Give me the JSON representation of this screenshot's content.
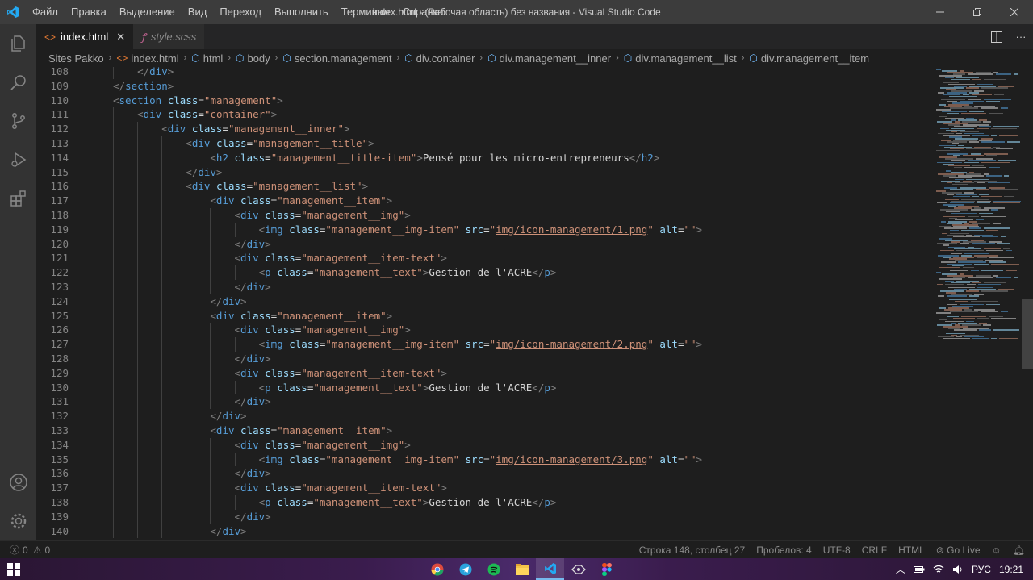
{
  "titlebar": {
    "menu": [
      "Файл",
      "Правка",
      "Выделение",
      "Вид",
      "Переход",
      "Выполнить",
      "Терминал",
      "Справка"
    ],
    "title": "index.html - (Рабочая область) без названия - Visual Studio Code"
  },
  "tabs": [
    {
      "label": "index.html",
      "icon": "html-file-icon",
      "active": true
    },
    {
      "label": "style.scss",
      "icon": "scss-file-icon",
      "active": false
    }
  ],
  "breadcrumb": [
    "Sites Pakko",
    "index.html",
    "html",
    "body",
    "section.management",
    "div.container",
    "div.management__inner",
    "div.management__list",
    "div.management__item"
  ],
  "editor": {
    "lines": [
      {
        "n": "108",
        "indent": 1,
        "tokens": [
          [
            "br",
            "</"
          ],
          [
            "tag",
            "div"
          ],
          [
            "br",
            ">"
          ]
        ]
      },
      {
        "n": "109",
        "indent": 0,
        "tokens": [
          [
            "br",
            "</"
          ],
          [
            "tag",
            "section"
          ],
          [
            "br",
            ">"
          ]
        ]
      },
      {
        "n": "110",
        "indent": 0,
        "tokens": [
          [
            "br",
            "<"
          ],
          [
            "tag",
            "section"
          ],
          [
            "txt",
            " "
          ],
          [
            "attr",
            "class"
          ],
          [
            "eq",
            "="
          ],
          [
            "str",
            "\"management\""
          ],
          [
            "br",
            ">"
          ]
        ]
      },
      {
        "n": "111",
        "indent": 1,
        "tokens": [
          [
            "br",
            "<"
          ],
          [
            "tag",
            "div"
          ],
          [
            "txt",
            " "
          ],
          [
            "attr",
            "class"
          ],
          [
            "eq",
            "="
          ],
          [
            "str",
            "\"container\""
          ],
          [
            "br",
            ">"
          ]
        ]
      },
      {
        "n": "112",
        "indent": 2,
        "tokens": [
          [
            "br",
            "<"
          ],
          [
            "tag",
            "div"
          ],
          [
            "txt",
            " "
          ],
          [
            "attr",
            "class"
          ],
          [
            "eq",
            "="
          ],
          [
            "str",
            "\"management__inner\""
          ],
          [
            "br",
            ">"
          ]
        ]
      },
      {
        "n": "113",
        "indent": 3,
        "tokens": [
          [
            "br",
            "<"
          ],
          [
            "tag",
            "div"
          ],
          [
            "txt",
            " "
          ],
          [
            "attr",
            "class"
          ],
          [
            "eq",
            "="
          ],
          [
            "str",
            "\"management__title\""
          ],
          [
            "br",
            ">"
          ]
        ]
      },
      {
        "n": "114",
        "indent": 4,
        "tokens": [
          [
            "br",
            "<"
          ],
          [
            "tag",
            "h2"
          ],
          [
            "txt",
            " "
          ],
          [
            "attr",
            "class"
          ],
          [
            "eq",
            "="
          ],
          [
            "str",
            "\"management__title-item\""
          ],
          [
            "br",
            ">"
          ],
          [
            "txt",
            "Pensé pour les micro-entrepreneurs"
          ],
          [
            "br",
            "</"
          ],
          [
            "tag",
            "h2"
          ],
          [
            "br",
            ">"
          ]
        ]
      },
      {
        "n": "115",
        "indent": 3,
        "tokens": [
          [
            "br",
            "</"
          ],
          [
            "tag",
            "div"
          ],
          [
            "br",
            ">"
          ]
        ]
      },
      {
        "n": "116",
        "indent": 3,
        "tokens": [
          [
            "br",
            "<"
          ],
          [
            "tag",
            "div"
          ],
          [
            "txt",
            " "
          ],
          [
            "attr",
            "class"
          ],
          [
            "eq",
            "="
          ],
          [
            "str",
            "\"management__list\""
          ],
          [
            "br",
            ">"
          ]
        ]
      },
      {
        "n": "117",
        "indent": 4,
        "tokens": [
          [
            "br",
            "<"
          ],
          [
            "tag",
            "div"
          ],
          [
            "txt",
            " "
          ],
          [
            "attr",
            "class"
          ],
          [
            "eq",
            "="
          ],
          [
            "str",
            "\"management__item\""
          ],
          [
            "br",
            ">"
          ]
        ]
      },
      {
        "n": "118",
        "indent": 5,
        "tokens": [
          [
            "br",
            "<"
          ],
          [
            "tag",
            "div"
          ],
          [
            "txt",
            " "
          ],
          [
            "attr",
            "class"
          ],
          [
            "eq",
            "="
          ],
          [
            "str",
            "\"management__img\""
          ],
          [
            "br",
            ">"
          ]
        ]
      },
      {
        "n": "119",
        "indent": 6,
        "tokens": [
          [
            "br",
            "<"
          ],
          [
            "tag",
            "img"
          ],
          [
            "txt",
            " "
          ],
          [
            "attr",
            "class"
          ],
          [
            "eq",
            "="
          ],
          [
            "str",
            "\"management__img-item\""
          ],
          [
            "txt",
            " "
          ],
          [
            "attr",
            "src"
          ],
          [
            "eq",
            "="
          ],
          [
            "str",
            "\""
          ],
          [
            "link",
            "img/icon-management/1.png"
          ],
          [
            "str",
            "\""
          ],
          [
            "txt",
            " "
          ],
          [
            "attr",
            "alt"
          ],
          [
            "eq",
            "="
          ],
          [
            "str",
            "\"\""
          ],
          [
            "br",
            ">"
          ]
        ]
      },
      {
        "n": "120",
        "indent": 5,
        "tokens": [
          [
            "br",
            "</"
          ],
          [
            "tag",
            "div"
          ],
          [
            "br",
            ">"
          ]
        ]
      },
      {
        "n": "121",
        "indent": 5,
        "tokens": [
          [
            "br",
            "<"
          ],
          [
            "tag",
            "div"
          ],
          [
            "txt",
            " "
          ],
          [
            "attr",
            "class"
          ],
          [
            "eq",
            "="
          ],
          [
            "str",
            "\"management__item-text\""
          ],
          [
            "br",
            ">"
          ]
        ]
      },
      {
        "n": "122",
        "indent": 6,
        "tokens": [
          [
            "br",
            "<"
          ],
          [
            "tag",
            "p"
          ],
          [
            "txt",
            " "
          ],
          [
            "attr",
            "class"
          ],
          [
            "eq",
            "="
          ],
          [
            "str",
            "\"management__text\""
          ],
          [
            "br",
            ">"
          ],
          [
            "txt",
            "Gestion de l'ACRE"
          ],
          [
            "br",
            "</"
          ],
          [
            "tag",
            "p"
          ],
          [
            "br",
            ">"
          ]
        ]
      },
      {
        "n": "123",
        "indent": 5,
        "tokens": [
          [
            "br",
            "</"
          ],
          [
            "tag",
            "div"
          ],
          [
            "br",
            ">"
          ]
        ]
      },
      {
        "n": "124",
        "indent": 4,
        "tokens": [
          [
            "br",
            "</"
          ],
          [
            "tag",
            "div"
          ],
          [
            "br",
            ">"
          ]
        ]
      },
      {
        "n": "125",
        "indent": 4,
        "tokens": [
          [
            "br",
            "<"
          ],
          [
            "tag",
            "div"
          ],
          [
            "txt",
            " "
          ],
          [
            "attr",
            "class"
          ],
          [
            "eq",
            "="
          ],
          [
            "str",
            "\"management__item\""
          ],
          [
            "br",
            ">"
          ]
        ]
      },
      {
        "n": "126",
        "indent": 5,
        "tokens": [
          [
            "br",
            "<"
          ],
          [
            "tag",
            "div"
          ],
          [
            "txt",
            " "
          ],
          [
            "attr",
            "class"
          ],
          [
            "eq",
            "="
          ],
          [
            "str",
            "\"management__img\""
          ],
          [
            "br",
            ">"
          ]
        ]
      },
      {
        "n": "127",
        "indent": 6,
        "tokens": [
          [
            "br",
            "<"
          ],
          [
            "tag",
            "img"
          ],
          [
            "txt",
            " "
          ],
          [
            "attr",
            "class"
          ],
          [
            "eq",
            "="
          ],
          [
            "str",
            "\"management__img-item\""
          ],
          [
            "txt",
            " "
          ],
          [
            "attr",
            "src"
          ],
          [
            "eq",
            "="
          ],
          [
            "str",
            "\""
          ],
          [
            "link",
            "img/icon-management/2.png"
          ],
          [
            "str",
            "\""
          ],
          [
            "txt",
            " "
          ],
          [
            "attr",
            "alt"
          ],
          [
            "eq",
            "="
          ],
          [
            "str",
            "\"\""
          ],
          [
            "br",
            ">"
          ]
        ]
      },
      {
        "n": "128",
        "indent": 5,
        "tokens": [
          [
            "br",
            "</"
          ],
          [
            "tag",
            "div"
          ],
          [
            "br",
            ">"
          ]
        ]
      },
      {
        "n": "129",
        "indent": 5,
        "tokens": [
          [
            "br",
            "<"
          ],
          [
            "tag",
            "div"
          ],
          [
            "txt",
            " "
          ],
          [
            "attr",
            "class"
          ],
          [
            "eq",
            "="
          ],
          [
            "str",
            "\"management__item-text\""
          ],
          [
            "br",
            ">"
          ]
        ]
      },
      {
        "n": "130",
        "indent": 6,
        "tokens": [
          [
            "br",
            "<"
          ],
          [
            "tag",
            "p"
          ],
          [
            "txt",
            " "
          ],
          [
            "attr",
            "class"
          ],
          [
            "eq",
            "="
          ],
          [
            "str",
            "\"management__text\""
          ],
          [
            "br",
            ">"
          ],
          [
            "txt",
            "Gestion de l'ACRE"
          ],
          [
            "br",
            "</"
          ],
          [
            "tag",
            "p"
          ],
          [
            "br",
            ">"
          ]
        ]
      },
      {
        "n": "131",
        "indent": 5,
        "tokens": [
          [
            "br",
            "</"
          ],
          [
            "tag",
            "div"
          ],
          [
            "br",
            ">"
          ]
        ]
      },
      {
        "n": "132",
        "indent": 4,
        "tokens": [
          [
            "br",
            "</"
          ],
          [
            "tag",
            "div"
          ],
          [
            "br",
            ">"
          ]
        ]
      },
      {
        "n": "133",
        "indent": 4,
        "tokens": [
          [
            "br",
            "<"
          ],
          [
            "tag",
            "div"
          ],
          [
            "txt",
            " "
          ],
          [
            "attr",
            "class"
          ],
          [
            "eq",
            "="
          ],
          [
            "str",
            "\"management__item\""
          ],
          [
            "br",
            ">"
          ]
        ]
      },
      {
        "n": "134",
        "indent": 5,
        "tokens": [
          [
            "br",
            "<"
          ],
          [
            "tag",
            "div"
          ],
          [
            "txt",
            " "
          ],
          [
            "attr",
            "class"
          ],
          [
            "eq",
            "="
          ],
          [
            "str",
            "\"management__img\""
          ],
          [
            "br",
            ">"
          ]
        ]
      },
      {
        "n": "135",
        "indent": 6,
        "tokens": [
          [
            "br",
            "<"
          ],
          [
            "tag",
            "img"
          ],
          [
            "txt",
            " "
          ],
          [
            "attr",
            "class"
          ],
          [
            "eq",
            "="
          ],
          [
            "str",
            "\"management__img-item\""
          ],
          [
            "txt",
            " "
          ],
          [
            "attr",
            "src"
          ],
          [
            "eq",
            "="
          ],
          [
            "str",
            "\""
          ],
          [
            "link",
            "img/icon-management/3.png"
          ],
          [
            "str",
            "\""
          ],
          [
            "txt",
            " "
          ],
          [
            "attr",
            "alt"
          ],
          [
            "eq",
            "="
          ],
          [
            "str",
            "\"\""
          ],
          [
            "br",
            ">"
          ]
        ]
      },
      {
        "n": "136",
        "indent": 5,
        "tokens": [
          [
            "br",
            "</"
          ],
          [
            "tag",
            "div"
          ],
          [
            "br",
            ">"
          ]
        ]
      },
      {
        "n": "137",
        "indent": 5,
        "tokens": [
          [
            "br",
            "<"
          ],
          [
            "tag",
            "div"
          ],
          [
            "txt",
            " "
          ],
          [
            "attr",
            "class"
          ],
          [
            "eq",
            "="
          ],
          [
            "str",
            "\"management__item-text\""
          ],
          [
            "br",
            ">"
          ]
        ]
      },
      {
        "n": "138",
        "indent": 6,
        "tokens": [
          [
            "br",
            "<"
          ],
          [
            "tag",
            "p"
          ],
          [
            "txt",
            " "
          ],
          [
            "attr",
            "class"
          ],
          [
            "eq",
            "="
          ],
          [
            "str",
            "\"management__text\""
          ],
          [
            "br",
            ">"
          ],
          [
            "txt",
            "Gestion de l'ACRE"
          ],
          [
            "br",
            "</"
          ],
          [
            "tag",
            "p"
          ],
          [
            "br",
            ">"
          ]
        ]
      },
      {
        "n": "139",
        "indent": 5,
        "tokens": [
          [
            "br",
            "</"
          ],
          [
            "tag",
            "div"
          ],
          [
            "br",
            ">"
          ]
        ]
      },
      {
        "n": "140",
        "indent": 4,
        "tokens": [
          [
            "br",
            "</"
          ],
          [
            "tag",
            "div"
          ],
          [
            "br",
            ">"
          ]
        ]
      }
    ]
  },
  "statusbar": {
    "errors": "0",
    "warnings": "0",
    "position": "Строка 148, столбец 27",
    "spaces": "Пробелов: 4",
    "encoding": "UTF-8",
    "eol": "CRLF",
    "language": "HTML",
    "golive": "Go Live"
  },
  "taskbar": {
    "apps": [
      "chrome-icon",
      "telegram-icon",
      "spotify-icon",
      "file-explorer-icon",
      "vscode-icon",
      "app-icon",
      "figma-icon"
    ],
    "lang": "РУС",
    "time": "19:21"
  },
  "colors": {
    "tag": "#569cd6",
    "attr": "#9cdcfe",
    "string": "#ce9178",
    "text": "#d4d4d4",
    "accent": "#007acc"
  }
}
